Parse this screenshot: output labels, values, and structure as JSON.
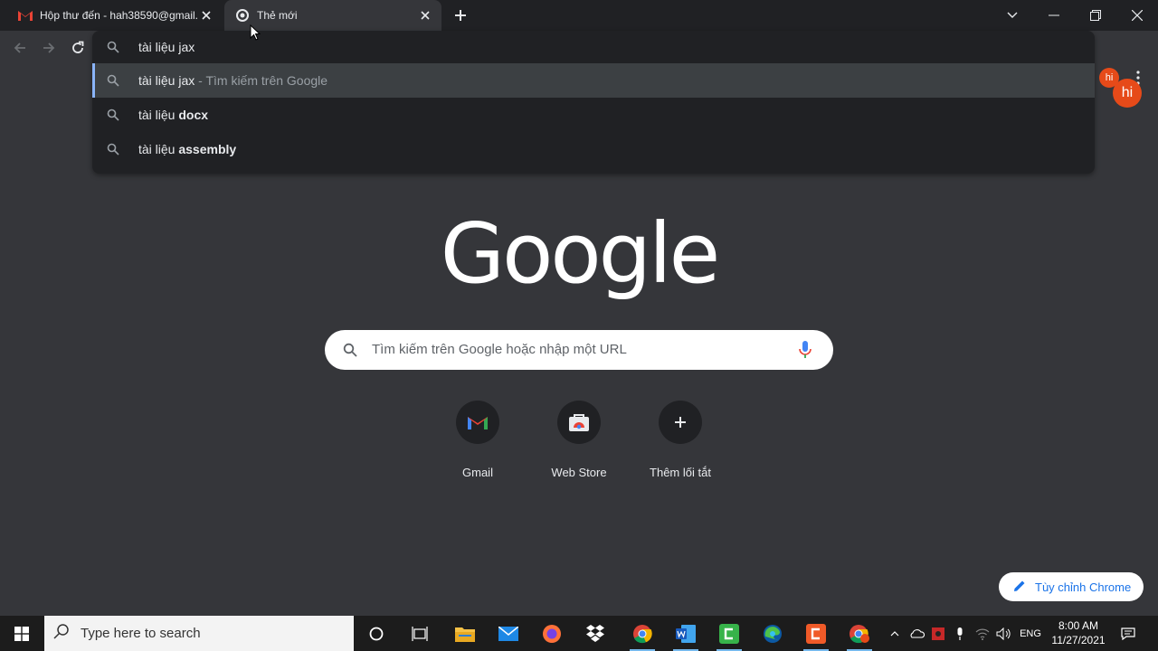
{
  "tabs": [
    {
      "title": "Hộp thư đến - hah38590@gmail.",
      "favicon": "gmail-icon",
      "active": false
    },
    {
      "title": "Thẻ mới",
      "favicon": "chrome-icon",
      "active": true
    }
  ],
  "omnibox": {
    "input_value": "tài liệu jax",
    "suggestions": [
      {
        "text": "tài liệu jax",
        "suffix": " - Tìm kiếm trên Google",
        "selected": true
      },
      {
        "prefix": "tài liệu ",
        "bold": "docx",
        "selected": false
      },
      {
        "prefix": "tài liệu ",
        "bold": "assembly",
        "selected": false
      }
    ]
  },
  "profile": {
    "initials": "hi",
    "color": "#e64a19"
  },
  "ntp": {
    "logo_text": "Google",
    "search_placeholder": "Tìm kiếm trên Google hoặc nhập một URL",
    "shortcuts": [
      {
        "label": "Gmail",
        "icon": "gmail-icon"
      },
      {
        "label": "Web Store",
        "icon": "webstore-icon"
      },
      {
        "label": "Thêm lối tắt",
        "icon": "plus-icon"
      }
    ],
    "customize_label": "Tùy chỉnh Chrome"
  },
  "taskbar": {
    "search_placeholder": "Type here to search",
    "language": "ENG",
    "time": "8:00 AM",
    "date": "11/27/2021"
  },
  "colors": {
    "tabstrip": "#202124",
    "toolbar": "#35363a",
    "accent": "#8ab4f8",
    "link": "#1a73e8"
  }
}
